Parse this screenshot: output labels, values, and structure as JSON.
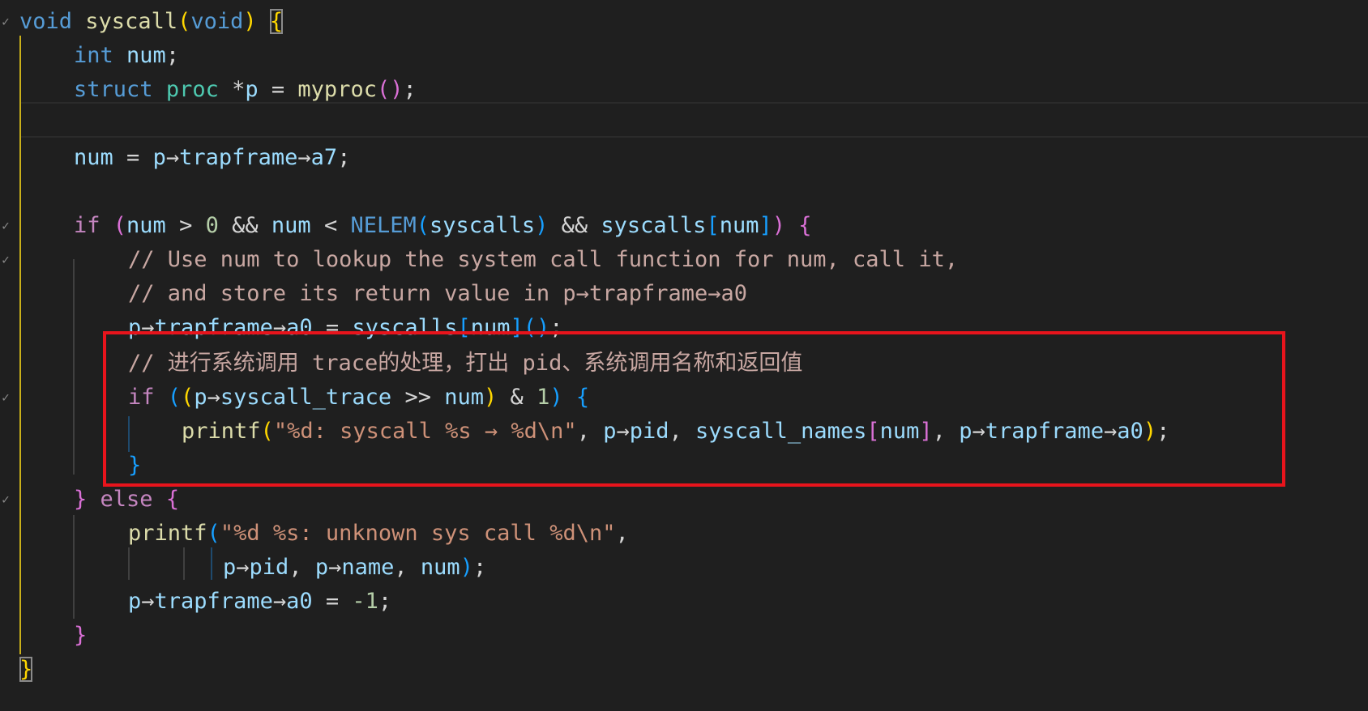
{
  "code_lines": [
    {
      "t": [
        "void",
        " ",
        "syscall",
        "(",
        "void",
        ")",
        " ",
        "{"
      ]
    },
    {
      "t": [
        "int",
        " ",
        "num",
        ";"
      ]
    },
    {
      "t": [
        "struct",
        " ",
        "proc",
        " ",
        "*",
        "p",
        " = ",
        "myproc",
        "(",
        ")",
        ";"
      ]
    },
    {
      "t": [
        ""
      ]
    },
    {
      "t": [
        "num",
        " = ",
        "p",
        "→",
        "trapframe",
        "→",
        "a7",
        ";"
      ]
    },
    {
      "t": [
        ""
      ]
    },
    {
      "t": [
        "if",
        " ",
        "(",
        "num",
        " > ",
        "0",
        " ",
        "&&",
        " ",
        "num",
        " < ",
        "NELEM",
        "(",
        "syscalls",
        ")",
        " ",
        "&&",
        " ",
        "syscalls",
        "[",
        "num",
        "]",
        ")",
        " ",
        "{"
      ]
    },
    {
      "t": [
        "// Use num to lookup the system call function for num, call it,"
      ]
    },
    {
      "t": [
        "// and store its return value in p→trapframe→a0"
      ]
    },
    {
      "t": [
        "p",
        "→",
        "trapframe",
        "→",
        "a0",
        " = ",
        "syscalls",
        "[",
        "num",
        "]",
        "(",
        ")",
        ";"
      ]
    },
    {
      "t": [
        "// 进行系统调用 trace的处理，打出 pid、系统调用名称和返回值"
      ]
    },
    {
      "t": [
        "if",
        " ",
        "(",
        "(",
        "p",
        "→",
        "syscall_trace",
        " ",
        ">>",
        " ",
        "num",
        ")",
        " ",
        "&",
        " ",
        "1",
        ")",
        " ",
        "{"
      ]
    },
    {
      "t": [
        "printf",
        "(",
        "\"%d: syscall %s → %d\\n\"",
        ", ",
        "p",
        "→",
        "pid",
        ", ",
        "syscall_names",
        "[",
        "num",
        "]",
        ", ",
        "p",
        "→",
        "trapframe",
        "→",
        "a0",
        ")",
        ";"
      ]
    },
    {
      "t": [
        "}"
      ]
    },
    {
      "t": [
        "}",
        " ",
        "else",
        " ",
        "{"
      ]
    },
    {
      "t": [
        "printf",
        "(",
        "\"%d %s: unknown sys call %d\\n\"",
        ","
      ]
    },
    {
      "t": [
        "p",
        "→",
        "pid",
        ", ",
        "p",
        "→",
        "name",
        ", ",
        "num",
        ")",
        ";"
      ]
    },
    {
      "t": [
        "p",
        "→",
        "trapframe",
        "→",
        "a0",
        " = ",
        "-1",
        ";"
      ]
    },
    {
      "t": [
        "}"
      ]
    },
    {
      "t": [
        "}"
      ]
    }
  ],
  "fold_glyph": "✓",
  "colors": {
    "background": "#1f1f1f",
    "highlight_box": "#e8141c",
    "keyword": "#569cd6",
    "control": "#c586c0",
    "function": "#dcdcaa",
    "variable": "#9cdcfe",
    "type": "#4ec9b0",
    "number": "#b5cea8",
    "string": "#ce9178",
    "comment": "#c8a7a2"
  }
}
